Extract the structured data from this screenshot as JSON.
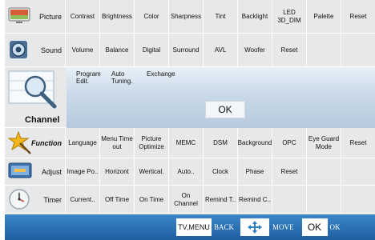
{
  "rows": {
    "picture": {
      "label": "Picture",
      "options": [
        "Contrast",
        "Brightness",
        "Color",
        "Sharpness",
        "Tint",
        "Backlight",
        "LED\n3D_DIM",
        "Palette",
        "Reset"
      ]
    },
    "sound": {
      "label": "Sound",
      "options": [
        "Volume",
        "Balance",
        "Digital",
        "Surround",
        "AVL",
        "Woofer",
        "Reset",
        "",
        ""
      ]
    },
    "channel": {
      "label": "Channel",
      "tabs": [
        "Program\nEdit.",
        "Auto\nTuning.",
        "Exchange"
      ],
      "ok_label": "OK"
    },
    "function": {
      "label": "Function",
      "options": [
        "Language",
        "Menu Time\nout",
        "Picture\nOptimize",
        "MEMC",
        "DSM",
        "Background",
        "OPC",
        "Eye Guard\nMode",
        "Reset"
      ]
    },
    "adjust": {
      "label": "Adjust",
      "options": [
        "Image Po..",
        "Horizont",
        "Wertical.",
        "Auto..",
        "Clock",
        "Phase",
        "Reset",
        "",
        ""
      ]
    },
    "timer": {
      "label": "Timer",
      "options": [
        "Current..",
        "Off Time",
        "On Time",
        "On Channel",
        "Remind T..",
        "Remind C..",
        "",
        "",
        ""
      ]
    }
  },
  "bottom_bar": {
    "menu_key": "TV,MENU",
    "back_hint": "BACK",
    "move_hint": "MOVE",
    "ok_key": "OK",
    "ok_hint": "OK"
  }
}
